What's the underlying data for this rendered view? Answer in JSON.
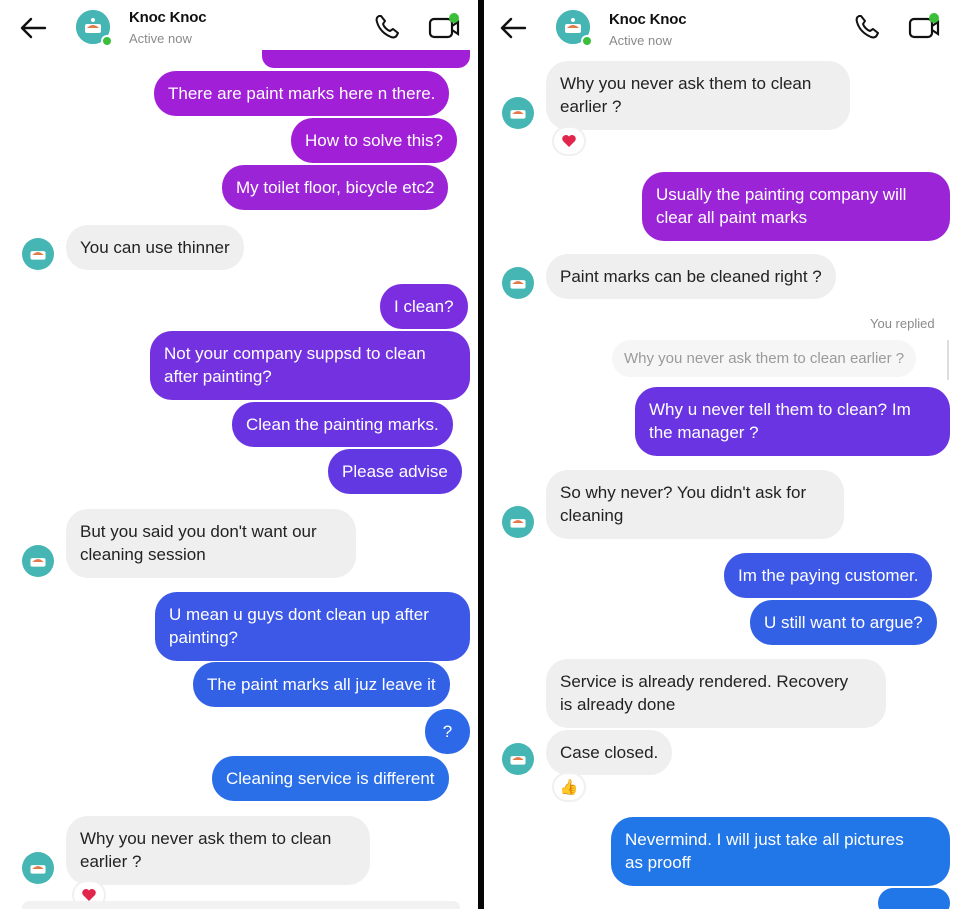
{
  "left": {
    "header": {
      "title": "Knoc Knoc",
      "status": "Active now"
    },
    "messages": [
      {
        "dir": "out",
        "text": "There are paint marks here n there.",
        "color": "#a21fd8"
      },
      {
        "dir": "out",
        "text": "How to solve this?",
        "color": "#a21fd8"
      },
      {
        "dir": "out",
        "text": "My toilet floor, bicycle etc2",
        "color": "#9a24d6"
      },
      {
        "dir": "in",
        "text": "You can use thinner"
      },
      {
        "dir": "out",
        "text": "I clean?",
        "color": "#7a2ee0"
      },
      {
        "dir": "out",
        "text": "Not your company suppsd to clean\nafter painting?",
        "color": "#7431e0"
      },
      {
        "dir": "out",
        "text": "Clean the painting marks.",
        "color": "#6a34e2"
      },
      {
        "dir": "out",
        "text": "Please advise",
        "color": "#6238e3"
      },
      {
        "dir": "in",
        "text": "But you said you don't want our\ncleaning session"
      },
      {
        "dir": "out",
        "text": "U mean u guys dont clean up after\npainting?",
        "color": "#3d58e6"
      },
      {
        "dir": "out",
        "text": "The paint marks all juz leave it",
        "color": "#3361e6"
      },
      {
        "dir": "out",
        "text": "?",
        "color": "#2c68e8"
      },
      {
        "dir": "out",
        "text": "Cleaning service is different",
        "color": "#2a6fe8"
      },
      {
        "dir": "in",
        "text": "Why you never ask them to clean\nearlier ?",
        "reaction": "heart"
      }
    ]
  },
  "right": {
    "header": {
      "title": "Knoc Knoc",
      "status": "Active now"
    },
    "messages": [
      {
        "dir": "in",
        "text": "Why you never ask them to clean\nearlier ?",
        "reaction": "heart"
      },
      {
        "dir": "out",
        "text": "Usually the painting company will\nclear all paint marks",
        "color": "#9a24d6"
      },
      {
        "dir": "in",
        "text": "Paint marks can be cleaned right ?"
      },
      {
        "dir": "label",
        "text": "You replied"
      },
      {
        "dir": "reply-preview",
        "text": "Why you never ask them to clean earlier ?"
      },
      {
        "dir": "out",
        "text": "Why u never tell them to clean? Im\nthe manager ?",
        "color": "#6a34e2"
      },
      {
        "dir": "in",
        "text": "So why never? You didn't ask for\ncleaning"
      },
      {
        "dir": "out",
        "text": "Im the paying customer.",
        "color": "#3d58e6"
      },
      {
        "dir": "out",
        "text": "U still want to argue?",
        "color": "#3361e6"
      },
      {
        "dir": "in",
        "text": "Service is already rendered. Recovery\nis already done"
      },
      {
        "dir": "in",
        "text": "Case closed.",
        "reaction": "thumbs-up"
      },
      {
        "dir": "out",
        "text": "Nevermind. I will just take all pictures\nas prooff",
        "color": "#2176e8"
      }
    ]
  },
  "icons": [
    "back-arrow-icon",
    "avatar-icon",
    "phone-icon",
    "video-call-icon",
    "heart-icon",
    "thumbs-up-icon"
  ]
}
